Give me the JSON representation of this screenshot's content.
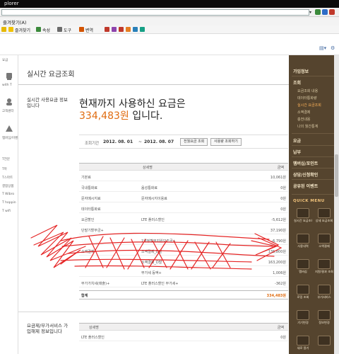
{
  "window": {
    "title": "plorer"
  },
  "menu": {
    "items": [
      "즐겨찾기(A)"
    ]
  },
  "toolbar": {
    "items": [
      "즐겨찾기",
      "속성",
      "도구",
      "변역"
    ]
  },
  "page": {
    "title": "실시간 요금조회",
    "section_label": "실시간 사용요금 정보입니다",
    "headline_line1": "현재까지 사용하신 요금은",
    "amount": "334,483원",
    "headline_suffix": "입니다."
  },
  "period": {
    "label": "조회기간",
    "from": "2012. 08. 01",
    "sep": "~",
    "to": "2012. 08. 07",
    "button_detail": "전월요금 조회",
    "button_usage": "사용량 조회하기"
  },
  "bill_table": {
    "headers": [
      "상세명",
      "금액"
    ],
    "rows": [
      {
        "c1": "기본료",
        "c2": "",
        "c3": "10,061원"
      },
      {
        "c1": "국내통화료",
        "c2": "음성통화료",
        "c3": "0원"
      },
      {
        "c1": "문자메시지료",
        "c2": "문자메시지이용료",
        "c3": "0원"
      },
      {
        "c1": "데이터통화료",
        "c2": "",
        "c3": "0원"
      },
      {
        "c1": "요금할인",
        "c2": "LTE 플러스할인",
        "c3": "-5,612원"
      },
      {
        "c1": "단말기할부금+",
        "c2": "",
        "c3": "37,190원"
      },
      {
        "c1": "",
        "c2": "1약정할부지원보조금+",
        "c3": "-6,790원"
      },
      {
        "c1": "소액결제",
        "c2": "소액결제_D발",
        "c3": "135,800원"
      },
      {
        "c1": "",
        "c2": "소액결제_D발",
        "c3": "163,200원"
      },
      {
        "c1": "",
        "c2": "부가세 등액+",
        "c3": "1,006원"
      },
      {
        "c1": "부가가치세(매출)+",
        "c2": "LTE 플러스할인 부가세+",
        "c3": "-362원"
      }
    ],
    "total_label": "합계",
    "total_value": "334,483원"
  },
  "plans": {
    "section_label": "요금제/부가서비스 가입해제 정보입니다",
    "headers": [
      "상세명",
      "금액"
    ],
    "rows": [
      {
        "c1": "LTE 플러스할인",
        "c2": "",
        "c3": "0원"
      }
    ]
  },
  "left_nav": {
    "items": [
      "요금",
      "with T",
      "고객센터",
      "멤버십/이벤트",
      "T전문",
      "T마",
      "T스마트",
      "결합상품",
      "T Wibro",
      "T hoppin",
      "T wifi"
    ]
  },
  "right_nav": {
    "top": "가입정보",
    "group1": "조회",
    "group1_items": [
      "요금조회 내용",
      "데이터통화량",
      "실시간 요금조회",
      "소액결제",
      "충전내용",
      "나의 월간통계"
    ],
    "active_index": 2,
    "group2": "요금",
    "group3": "납부",
    "group4": "멤버십/포인트",
    "group5": "상담/신청확인",
    "group6": "공유된 이벤트",
    "quick_menu": "QUICK MENU",
    "tiles": [
      "실시간 요금조회",
      "상세 요금조회",
      "사용내역",
      "소액결제",
      "멤버십",
      "지원/결과 조회",
      "로밍 조회",
      "부가서비스",
      "기기변경",
      "정보변경",
      "새로 알기",
      ""
    ]
  },
  "colors": {
    "accent_amount": "#e06c10",
    "right_nav_bg": "#55442e",
    "active_link": "#ffb45a",
    "scribble": "#e10000"
  }
}
